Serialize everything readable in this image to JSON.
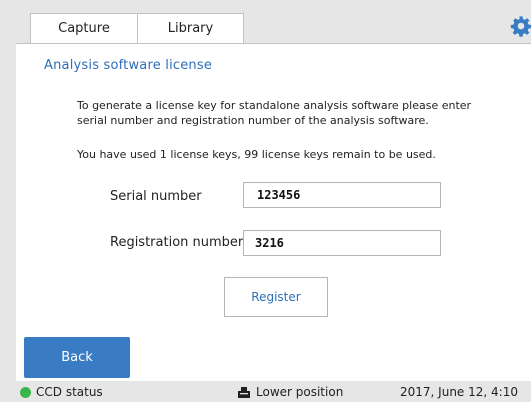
{
  "tabs": [
    {
      "label": "Capture"
    },
    {
      "label": "Library"
    }
  ],
  "icons": {
    "settings": "gear-icon",
    "position": "tray-icon",
    "status": "status-dot-icon"
  },
  "colors": {
    "accent": "#2e6fba",
    "back_button": "#3a7cc4",
    "status_ok": "#39b54a"
  },
  "panel": {
    "title": "Analysis software license",
    "description_line1": "To generate a license key for standalone analysis software please enter",
    "description_line2": "serial number and registration number of the analysis software.",
    "usage_text": "You have used 1 license keys, 99 license keys remain to be used.",
    "serial_label": "Serial number",
    "serial_value": "123456",
    "registration_label": "Registration number",
    "registration_value": "3216",
    "register_button": "Register"
  },
  "back_button": "Back",
  "status_bar": {
    "ccd_status": "CCD status",
    "position": "Lower position",
    "datetime": "2017, June 12, 4:10"
  }
}
